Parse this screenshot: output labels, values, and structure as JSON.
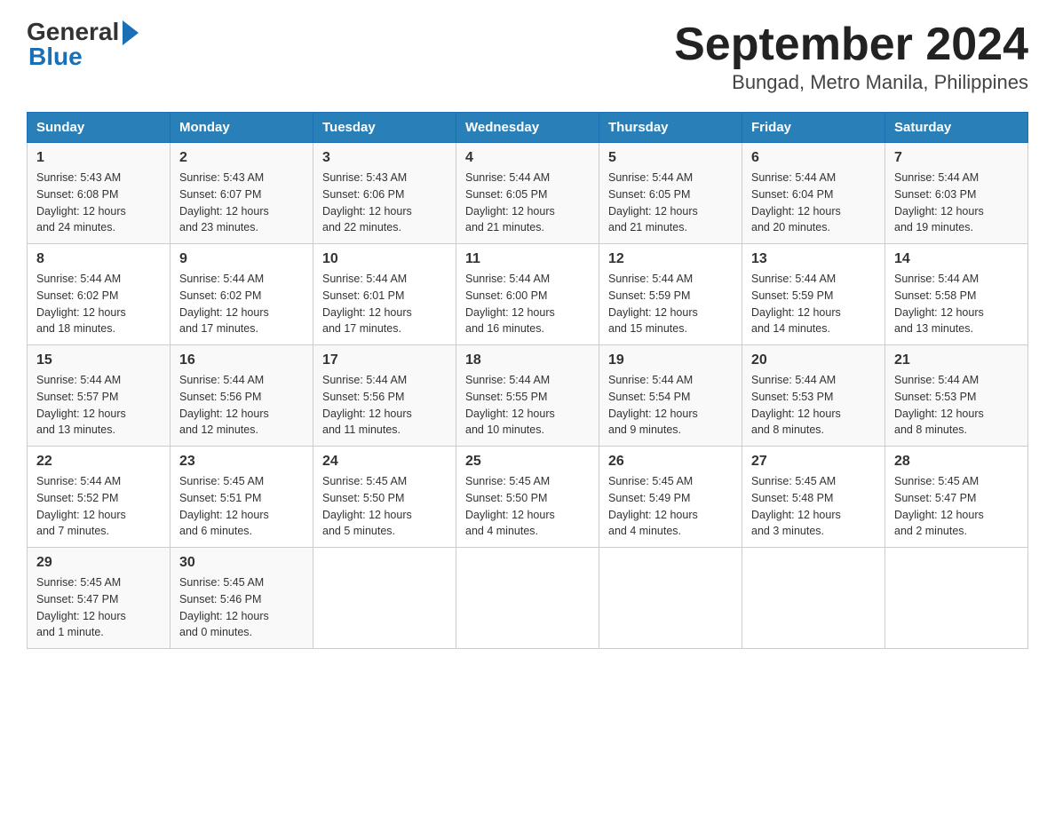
{
  "logo": {
    "general": "General",
    "blue": "Blue"
  },
  "title": "September 2024",
  "subtitle": "Bungad, Metro Manila, Philippines",
  "days_header": [
    "Sunday",
    "Monday",
    "Tuesday",
    "Wednesday",
    "Thursday",
    "Friday",
    "Saturday"
  ],
  "weeks": [
    [
      {
        "num": "1",
        "sunrise": "5:43 AM",
        "sunset": "6:08 PM",
        "daylight": "12 hours and 24 minutes."
      },
      {
        "num": "2",
        "sunrise": "5:43 AM",
        "sunset": "6:07 PM",
        "daylight": "12 hours and 23 minutes."
      },
      {
        "num": "3",
        "sunrise": "5:43 AM",
        "sunset": "6:06 PM",
        "daylight": "12 hours and 22 minutes."
      },
      {
        "num": "4",
        "sunrise": "5:44 AM",
        "sunset": "6:05 PM",
        "daylight": "12 hours and 21 minutes."
      },
      {
        "num": "5",
        "sunrise": "5:44 AM",
        "sunset": "6:05 PM",
        "daylight": "12 hours and 21 minutes."
      },
      {
        "num": "6",
        "sunrise": "5:44 AM",
        "sunset": "6:04 PM",
        "daylight": "12 hours and 20 minutes."
      },
      {
        "num": "7",
        "sunrise": "5:44 AM",
        "sunset": "6:03 PM",
        "daylight": "12 hours and 19 minutes."
      }
    ],
    [
      {
        "num": "8",
        "sunrise": "5:44 AM",
        "sunset": "6:02 PM",
        "daylight": "12 hours and 18 minutes."
      },
      {
        "num": "9",
        "sunrise": "5:44 AM",
        "sunset": "6:02 PM",
        "daylight": "12 hours and 17 minutes."
      },
      {
        "num": "10",
        "sunrise": "5:44 AM",
        "sunset": "6:01 PM",
        "daylight": "12 hours and 17 minutes."
      },
      {
        "num": "11",
        "sunrise": "5:44 AM",
        "sunset": "6:00 PM",
        "daylight": "12 hours and 16 minutes."
      },
      {
        "num": "12",
        "sunrise": "5:44 AM",
        "sunset": "5:59 PM",
        "daylight": "12 hours and 15 minutes."
      },
      {
        "num": "13",
        "sunrise": "5:44 AM",
        "sunset": "5:59 PM",
        "daylight": "12 hours and 14 minutes."
      },
      {
        "num": "14",
        "sunrise": "5:44 AM",
        "sunset": "5:58 PM",
        "daylight": "12 hours and 13 minutes."
      }
    ],
    [
      {
        "num": "15",
        "sunrise": "5:44 AM",
        "sunset": "5:57 PM",
        "daylight": "12 hours and 13 minutes."
      },
      {
        "num": "16",
        "sunrise": "5:44 AM",
        "sunset": "5:56 PM",
        "daylight": "12 hours and 12 minutes."
      },
      {
        "num": "17",
        "sunrise": "5:44 AM",
        "sunset": "5:56 PM",
        "daylight": "12 hours and 11 minutes."
      },
      {
        "num": "18",
        "sunrise": "5:44 AM",
        "sunset": "5:55 PM",
        "daylight": "12 hours and 10 minutes."
      },
      {
        "num": "19",
        "sunrise": "5:44 AM",
        "sunset": "5:54 PM",
        "daylight": "12 hours and 9 minutes."
      },
      {
        "num": "20",
        "sunrise": "5:44 AM",
        "sunset": "5:53 PM",
        "daylight": "12 hours and 8 minutes."
      },
      {
        "num": "21",
        "sunrise": "5:44 AM",
        "sunset": "5:53 PM",
        "daylight": "12 hours and 8 minutes."
      }
    ],
    [
      {
        "num": "22",
        "sunrise": "5:44 AM",
        "sunset": "5:52 PM",
        "daylight": "12 hours and 7 minutes."
      },
      {
        "num": "23",
        "sunrise": "5:45 AM",
        "sunset": "5:51 PM",
        "daylight": "12 hours and 6 minutes."
      },
      {
        "num": "24",
        "sunrise": "5:45 AM",
        "sunset": "5:50 PM",
        "daylight": "12 hours and 5 minutes."
      },
      {
        "num": "25",
        "sunrise": "5:45 AM",
        "sunset": "5:50 PM",
        "daylight": "12 hours and 4 minutes."
      },
      {
        "num": "26",
        "sunrise": "5:45 AM",
        "sunset": "5:49 PM",
        "daylight": "12 hours and 4 minutes."
      },
      {
        "num": "27",
        "sunrise": "5:45 AM",
        "sunset": "5:48 PM",
        "daylight": "12 hours and 3 minutes."
      },
      {
        "num": "28",
        "sunrise": "5:45 AM",
        "sunset": "5:47 PM",
        "daylight": "12 hours and 2 minutes."
      }
    ],
    [
      {
        "num": "29",
        "sunrise": "5:45 AM",
        "sunset": "5:47 PM",
        "daylight": "12 hours and 1 minute."
      },
      {
        "num": "30",
        "sunrise": "5:45 AM",
        "sunset": "5:46 PM",
        "daylight": "12 hours and 0 minutes."
      },
      null,
      null,
      null,
      null,
      null
    ]
  ],
  "labels": {
    "sunrise": "Sunrise:",
    "sunset": "Sunset:",
    "daylight": "Daylight:"
  }
}
